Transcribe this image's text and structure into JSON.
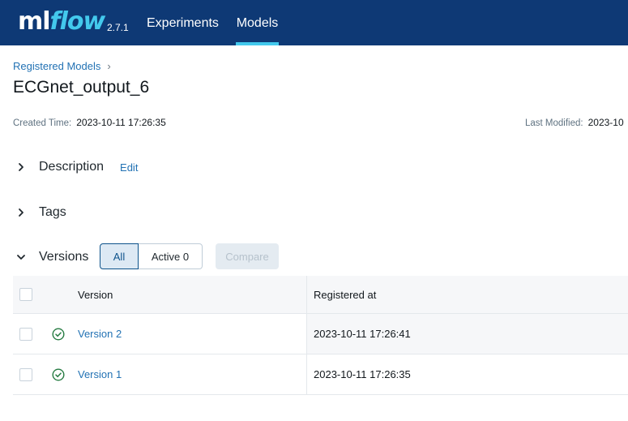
{
  "header": {
    "logo_ml": "ml",
    "logo_flow": "flow",
    "version": "2.7.1",
    "nav": [
      {
        "label": "Experiments",
        "active": false
      },
      {
        "label": "Models",
        "active": true
      }
    ],
    "colors": {
      "background": "#0e3975",
      "accent": "#43c9ed"
    }
  },
  "breadcrumb": {
    "items": [
      "Registered Models"
    ],
    "separator": "›"
  },
  "page": {
    "title": "ECGnet_output_6",
    "created_label": "Created Time:",
    "created_value": "2023-10-11 17:26:35",
    "modified_label": "Last Modified:",
    "modified_value": "2023-10"
  },
  "sections": {
    "description": {
      "title": "Description",
      "edit_label": "Edit",
      "expanded": false
    },
    "tags": {
      "title": "Tags",
      "expanded": false
    },
    "versions": {
      "title": "Versions",
      "expanded": true
    }
  },
  "versions_toolbar": {
    "filter_all": "All",
    "filter_active": "Active 0",
    "compare_label": "Compare",
    "selected_filter": "All"
  },
  "table": {
    "columns": [
      "Version",
      "Registered at"
    ],
    "rows": [
      {
        "version": "Version 2",
        "registered_at": "2023-10-11 17:26:41",
        "status": "ready"
      },
      {
        "version": "Version 1",
        "registered_at": "2023-10-11 17:26:35",
        "status": "ready"
      }
    ]
  },
  "icons": {
    "chevron_collapsed": "chevron-right-icon",
    "chevron_expanded": "chevron-down-icon",
    "status": "check-circle-icon"
  }
}
